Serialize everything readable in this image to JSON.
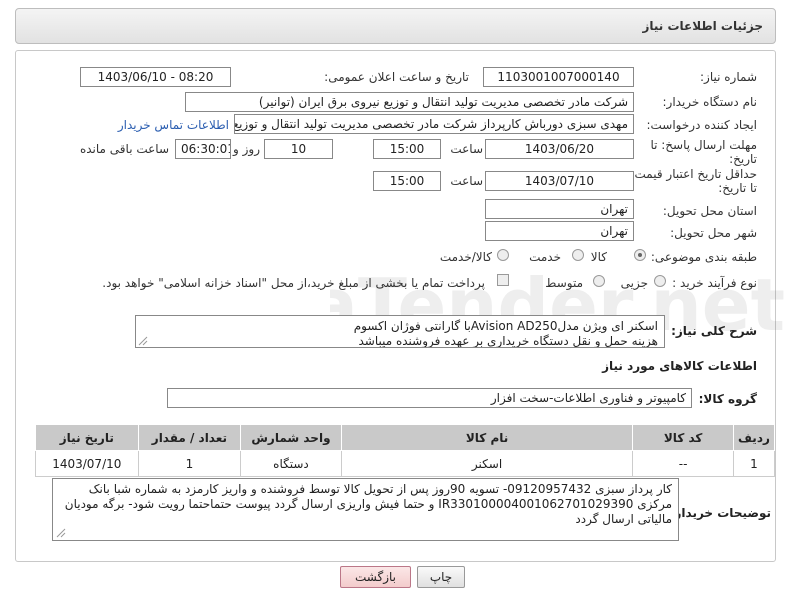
{
  "header": {
    "title": "جزئیات اطلاعات نیاز"
  },
  "need_number": {
    "label": "شماره نیاز:",
    "value": "1103001007000140"
  },
  "announce": {
    "label": "تاریخ و ساعت اعلان عمومی:",
    "value": "1403/06/10 - 08:20"
  },
  "buyer": {
    "label": "نام دستگاه خریدار:",
    "value": "شرکت مادر تخصصی مدیریت تولید  انتقال و توزیع نیروی برق ایران (توانیر)"
  },
  "creator": {
    "label": "ایجاد کننده درخواست:",
    "value": "مهدی سبزی دورباش کارپرداز شرکت مادر تخصصی مدیریت تولید  انتقال و توزیع نیروی برق",
    "contact_link": "اطلاعات تماس خریدار"
  },
  "reply_deadline": {
    "label": "مهلت ارسال پاسخ: تا تاریخ:",
    "date": "1403/06/20",
    "time_label": "ساعت",
    "time": "15:00",
    "days": "10",
    "days_label": "روز و",
    "remaining": "06:30:01",
    "remaining_label": "ساعت باقی مانده"
  },
  "price_validity": {
    "label": "حداقل تاریخ اعتبار قیمت: تا تاریخ:",
    "date": "1403/07/10",
    "time_label": "ساعت",
    "time": "15:00"
  },
  "province": {
    "label": "استان محل تحویل:",
    "value": "تهران"
  },
  "city": {
    "label": "شهر محل تحویل:",
    "value": "تهران"
  },
  "category": {
    "label": "طبقه بندی موضوعی:",
    "options": [
      "کالا",
      "خدمت",
      "کالا/خدمت"
    ],
    "selected": "کالا"
  },
  "process": {
    "label": "نوع فرآیند خرید :",
    "options": [
      "جزیی",
      "متوسط"
    ],
    "note": "پرداخت تمام یا بخشی از مبلغ خرید،از محل \"اسناد خزانه اسلامی\" خواهد بود."
  },
  "summary": {
    "label": "شرح کلی نیاز:",
    "line1": "اسکنر ای ویژن مدلAvision AD250با گارانتی فوژان اکسوم",
    "line2": "هزینه حمل و نقل دستگاه خریداری بر عهده فروشنده میباشد"
  },
  "goods_info": {
    "title": "اطلاعات کالاهای مورد نیاز"
  },
  "goods_group": {
    "label": "گروه کالا:",
    "value": "کامپیوتر و فناوری اطلاعات-سخت افزار"
  },
  "table": {
    "headers": [
      "ردیف",
      "کد کالا",
      "نام کالا",
      "واحد شمارش",
      "تعداد / مقدار",
      "تاریخ نیاز"
    ],
    "rows": [
      [
        "1",
        "--",
        "اسکنر",
        "دستگاه",
        "1",
        "1403/07/10"
      ]
    ]
  },
  "buyer_notes": {
    "label": "توضیحات خریدار:",
    "text": "کار پرداز سبزی 09120957432- تسویه 90روز پس از تحویل کالا توسط فروشنده و واریز کارمزد به شماره شبا بانک مرکزی IR330100004001062701029390 و حتما فیش واریزی ارسال گردد پیوست حتماحتما رویت شود- برگه مودیان مالیاتی ارسال گردد"
  },
  "buttons": {
    "print": "چاپ",
    "back": "بازگشت"
  },
  "watermark": "AriaTender.net"
}
